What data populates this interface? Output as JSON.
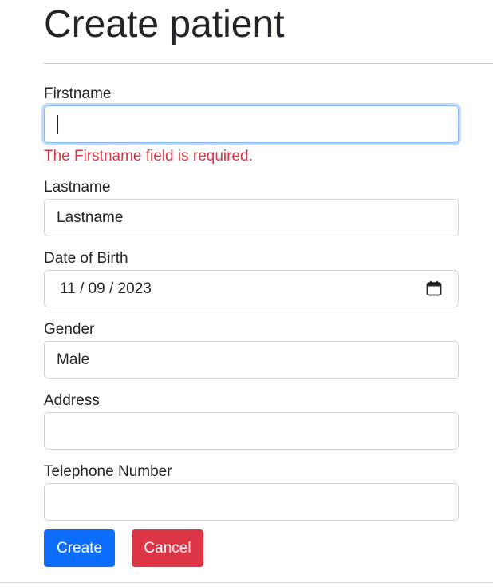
{
  "page": {
    "title": "Create patient"
  },
  "form": {
    "firstname": {
      "label": "Firstname",
      "value": "",
      "error": "The Firstname field is required."
    },
    "lastname": {
      "label": "Lastname",
      "value": "Lastname"
    },
    "dob": {
      "label": "Date of Birth",
      "value": "11 / 09 / 2023",
      "icon": "calendar-icon"
    },
    "gender": {
      "label": "Gender",
      "value": "Male"
    },
    "address": {
      "label": "Address",
      "value": ""
    },
    "telephone": {
      "label": "Telephone Number",
      "value": ""
    }
  },
  "buttons": {
    "create": "Create",
    "cancel": "Cancel"
  },
  "colors": {
    "primary": "#0d6efd",
    "danger": "#dc3545",
    "focus_border": "#86b7fe",
    "text": "#212529"
  }
}
